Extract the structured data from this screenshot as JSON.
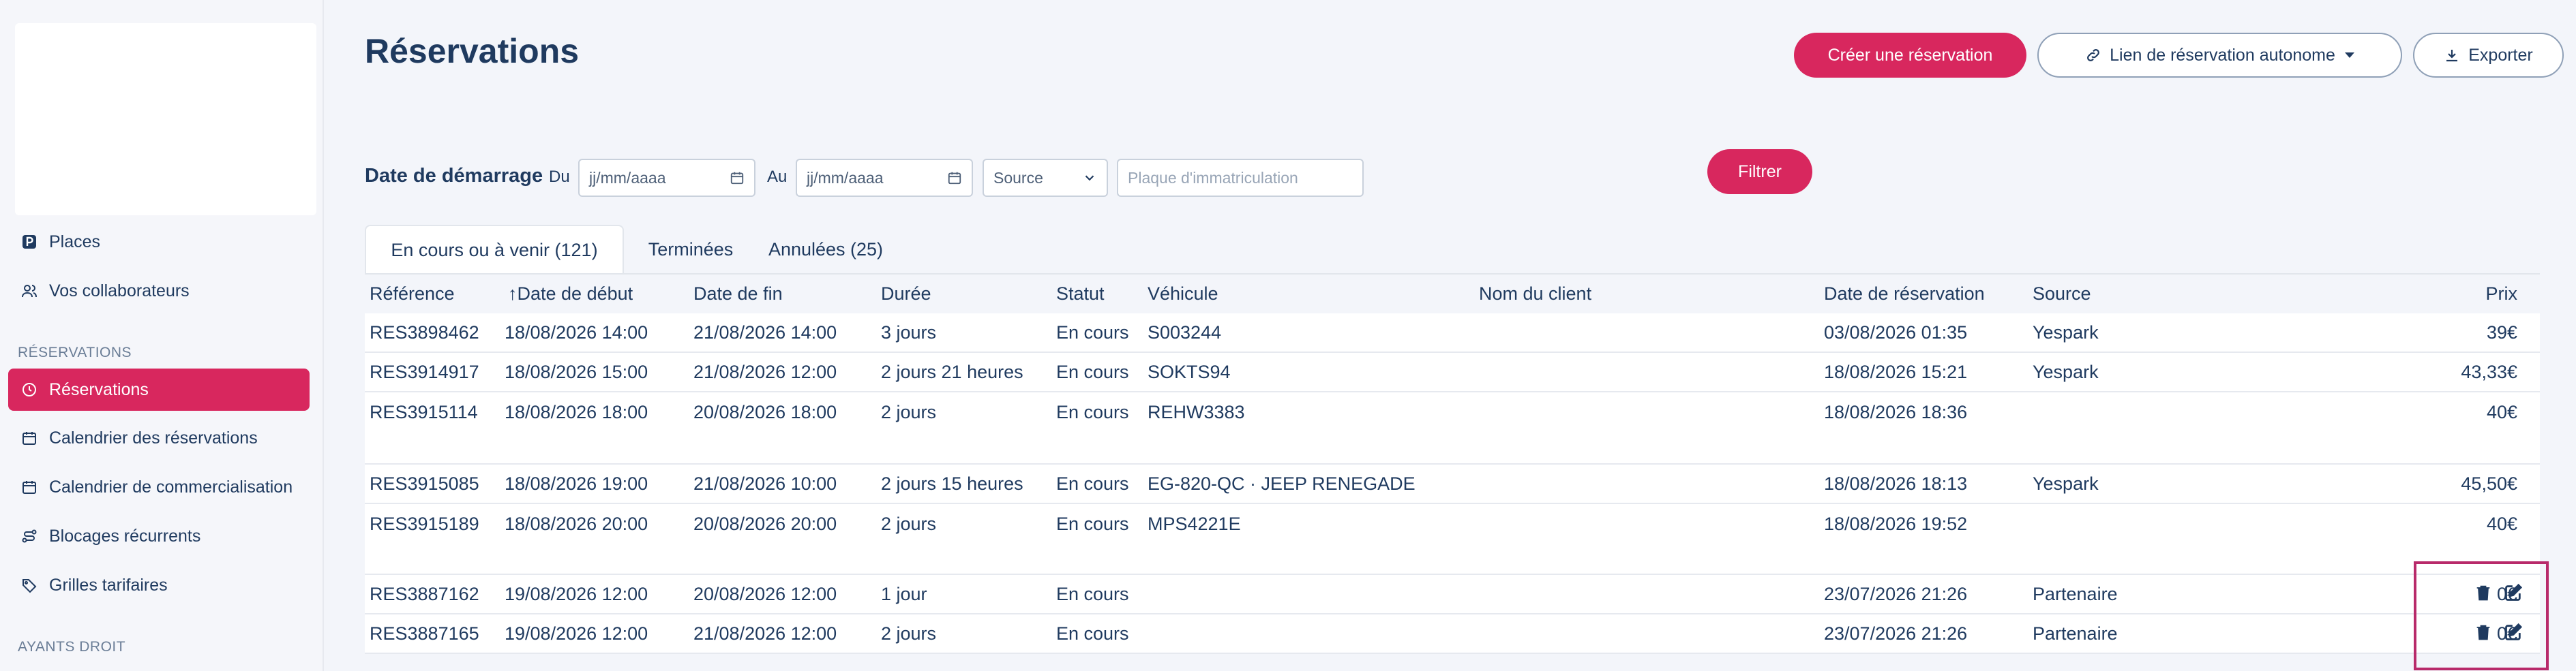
{
  "sidebar": {
    "items": [
      {
        "label": "Places",
        "icon": "parking-icon"
      },
      {
        "label": "Vos collaborateurs",
        "icon": "users-icon"
      }
    ],
    "section_reservations": "RÉSERVATIONS",
    "reservation_items": [
      {
        "label": "Réservations",
        "icon": "clock-icon",
        "active": true
      },
      {
        "label": "Calendrier des réservations",
        "icon": "calendar-icon"
      },
      {
        "label": "Calendrier de commercialisation",
        "icon": "calendar-icon"
      },
      {
        "label": "Blocages récurrents",
        "icon": "route-icon"
      },
      {
        "label": "Grilles tarifaires",
        "icon": "tag-icon"
      }
    ],
    "section_ayants": "AYANTS DROIT"
  },
  "header": {
    "title": "Réservations",
    "create_button": "Créer une réservation",
    "link_button": "Lien de réservation autonome",
    "export_button": "Exporter"
  },
  "filters": {
    "start_label": "Date de démarrage",
    "from_label": "Du",
    "to_label": "Au",
    "date_from_placeholder": "jj/mm/aaaa",
    "date_to_placeholder": "jj/mm/aaaa",
    "source_value": "Source",
    "plate_placeholder": "Plaque d'immatriculation",
    "filter_button": "Filtrer"
  },
  "tabs": [
    {
      "label": "En cours ou à venir (121)",
      "active": true
    },
    {
      "label": "Terminées"
    },
    {
      "label": "Annulées (25)"
    }
  ],
  "table": {
    "columns": [
      "Référence",
      "↑Date de début",
      "Date de fin",
      "Durée",
      "Statut",
      "Véhicule",
      "Nom du client",
      "Date de réservation",
      "Source",
      "Prix"
    ],
    "rows": [
      [
        "RES3898462",
        "18/08/2026 14:00",
        "21/08/2026 14:00",
        "3 jours",
        "En cours",
        "S003244",
        "",
        "03/08/2026 01:35",
        "Yespark",
        "39€"
      ],
      [
        "RES3914917",
        "18/08/2026 15:00",
        "21/08/2026 12:00",
        "2 jours 21 heures",
        "En cours",
        "SOKTS94",
        "",
        "18/08/2026 15:21",
        "Yespark",
        "43,33€"
      ],
      [
        "RES3915114",
        "18/08/2026 18:00",
        "20/08/2026 18:00",
        "2 jours",
        "En cours",
        "REHW3383",
        "",
        "18/08/2026 18:36",
        "",
        "40€"
      ],
      [
        "RES3915085",
        "18/08/2026 19:00",
        "21/08/2026 10:00",
        "2 jours 15 heures",
        "En cours",
        "EG-820-QC · JEEP RENEGADE",
        "",
        "18/08/2026 18:13",
        "Yespark",
        "45,50€"
      ],
      [
        "RES3915189",
        "18/08/2026 20:00",
        "20/08/2026 20:00",
        "2 jours",
        "En cours",
        "MPS4221E",
        "",
        "18/08/2026 19:52",
        "",
        "40€"
      ],
      [
        "RES3887162",
        "19/08/2026 12:00",
        "20/08/2026 12:00",
        "1 jour",
        "En cours",
        "",
        "",
        "23/07/2026 21:26",
        "Partenaire",
        "0€"
      ],
      [
        "RES3887165",
        "19/08/2026 12:00",
        "21/08/2026 12:00",
        "2 jours",
        "En cours",
        "",
        "",
        "23/07/2026 21:26",
        "Partenaire",
        "0€"
      ]
    ]
  },
  "colors": {
    "accent": "#d8275e",
    "text": "#1f3a5f",
    "highlight_box": "#b82a6a"
  }
}
